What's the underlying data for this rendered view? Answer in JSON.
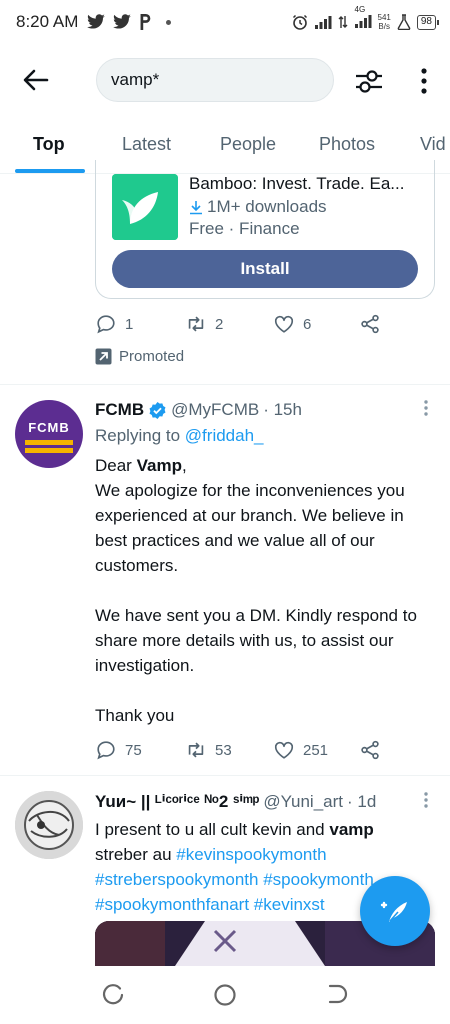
{
  "status_bar": {
    "time": "8:20 AM",
    "notification_icons": [
      "twitter-icon",
      "twitter-icon",
      "pinterest-icon",
      "dot-icon"
    ],
    "net_speed_value": "541",
    "net_speed_unit": "B/s",
    "battery": "98",
    "network_label": "4G"
  },
  "search": {
    "query": "vamp*"
  },
  "tabs": [
    {
      "label": "Top",
      "active": true
    },
    {
      "label": "Latest",
      "active": false
    },
    {
      "label": "People",
      "active": false
    },
    {
      "label": "Photos",
      "active": false
    },
    {
      "label": "Vid",
      "active": false
    }
  ],
  "promoted_tweet": {
    "app": {
      "name": "Bamboo: Invest. Trade. Ea...",
      "downloads": "1M+ downloads",
      "meta": "Free · Finance",
      "install_label": "Install",
      "icon_color": "#1fc98e"
    },
    "replies": "1",
    "retweets": "2",
    "likes": "6",
    "promoted_label": "Promoted"
  },
  "tweets": [
    {
      "display_name": "FCMB",
      "verified": true,
      "handle": "@MyFCMB",
      "time": "· 15h",
      "replying_prefix": "Replying to",
      "replying_to": "@friddah_",
      "avatar_text": "FCMB",
      "avatar_color": "#5c2d91",
      "body": {
        "greeting_prefix": "Dear",
        "greeting_name": "Vamp",
        "greeting_suffix": ",",
        "para1": "We apologize for the inconveniences you experienced at our branch. We believe in best practices and we value all of our customers.",
        "para2": "We have sent you a DM. Kindly respond to share more details with us, to assist our investigation.",
        "para3": "Thank you"
      },
      "replies": "75",
      "retweets": "53",
      "likes": "251"
    },
    {
      "display_name": "Yuи~ || ᴸⁱᶜᵒʳⁱᶜᵉ ᴺᵒ2 ˢⁱᵐᵖ",
      "handle": "@Yuni_art",
      "time": "· 1d",
      "body": {
        "text_before": "I present to u all cult kevin and",
        "bold_word": "vamp",
        "text_after": "streber au",
        "hashtag1": "#kevinspookymonth",
        "hashtag2": "#streberspookymonth",
        "hashtag3": "#spookymonth",
        "hashtag4": "#spookymonthfanart",
        "hashtag5": "#kevinxst"
      }
    }
  ],
  "colors": {
    "accent": "#1d9bf0",
    "install_button": "#4d6498",
    "secondary_text": "#536471"
  }
}
